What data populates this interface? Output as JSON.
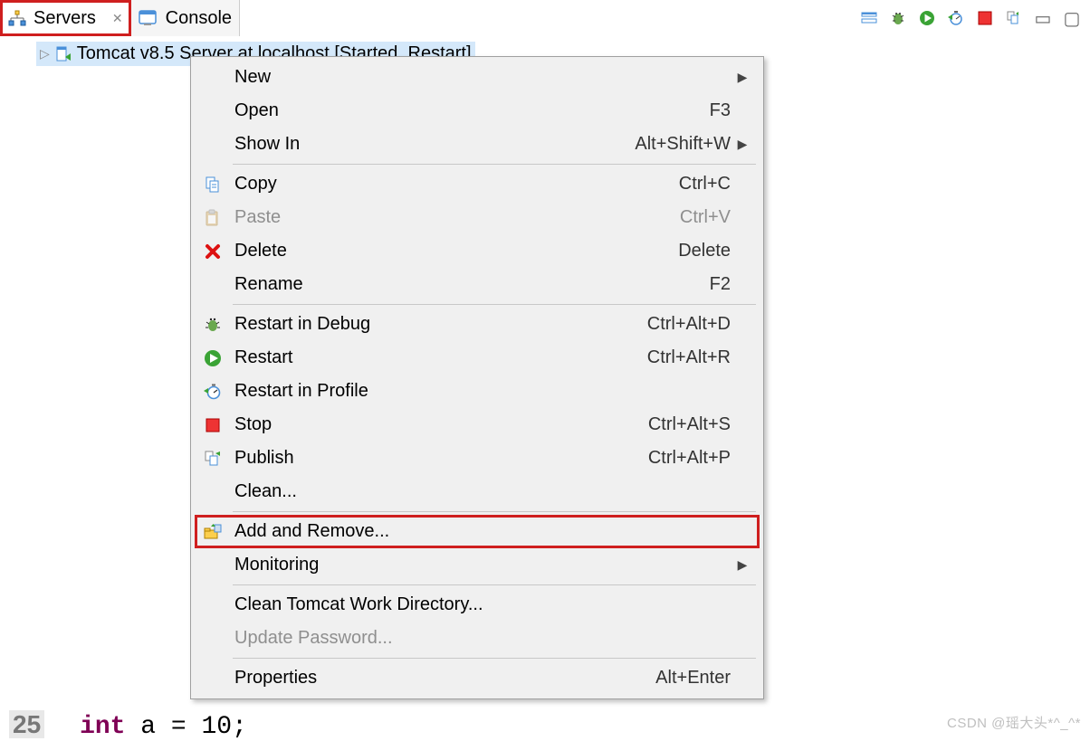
{
  "tabs": {
    "servers": {
      "label": "Servers"
    },
    "console": {
      "label": "Console"
    }
  },
  "server_row": {
    "label": "Tomcat v8.5 Server at localhost  [Started, Restart]"
  },
  "menu": {
    "new": {
      "label": "New",
      "arrow": true
    },
    "open": {
      "label": "Open",
      "shortcut": "F3"
    },
    "showin": {
      "label": "Show In",
      "shortcut": "Alt+Shift+W",
      "arrow": true
    },
    "copy": {
      "label": "Copy",
      "shortcut": "Ctrl+C"
    },
    "paste": {
      "label": "Paste",
      "shortcut": "Ctrl+V",
      "disabled": true
    },
    "delete": {
      "label": "Delete",
      "shortcut": "Delete"
    },
    "rename": {
      "label": "Rename",
      "shortcut": "F2"
    },
    "rdebug": {
      "label": "Restart in Debug",
      "shortcut": "Ctrl+Alt+D"
    },
    "restart": {
      "label": "Restart",
      "shortcut": "Ctrl+Alt+R"
    },
    "rprofile": {
      "label": "Restart in Profile"
    },
    "stop": {
      "label": "Stop",
      "shortcut": "Ctrl+Alt+S"
    },
    "publish": {
      "label": "Publish",
      "shortcut": "Ctrl+Alt+P"
    },
    "clean": {
      "label": "Clean..."
    },
    "addremove": {
      "label": "Add and Remove..."
    },
    "monitor": {
      "label": "Monitoring",
      "arrow": true
    },
    "cleanwork": {
      "label": "Clean Tomcat Work Directory..."
    },
    "updatepw": {
      "label": "Update Password...",
      "disabled": true
    },
    "props": {
      "label": "Properties",
      "shortcut": "Alt+Enter"
    }
  },
  "watermark": "CSDN @瑶大头*^_^*",
  "frag": {
    "num": "25",
    "kw": "int",
    "code": " a = 10;"
  }
}
